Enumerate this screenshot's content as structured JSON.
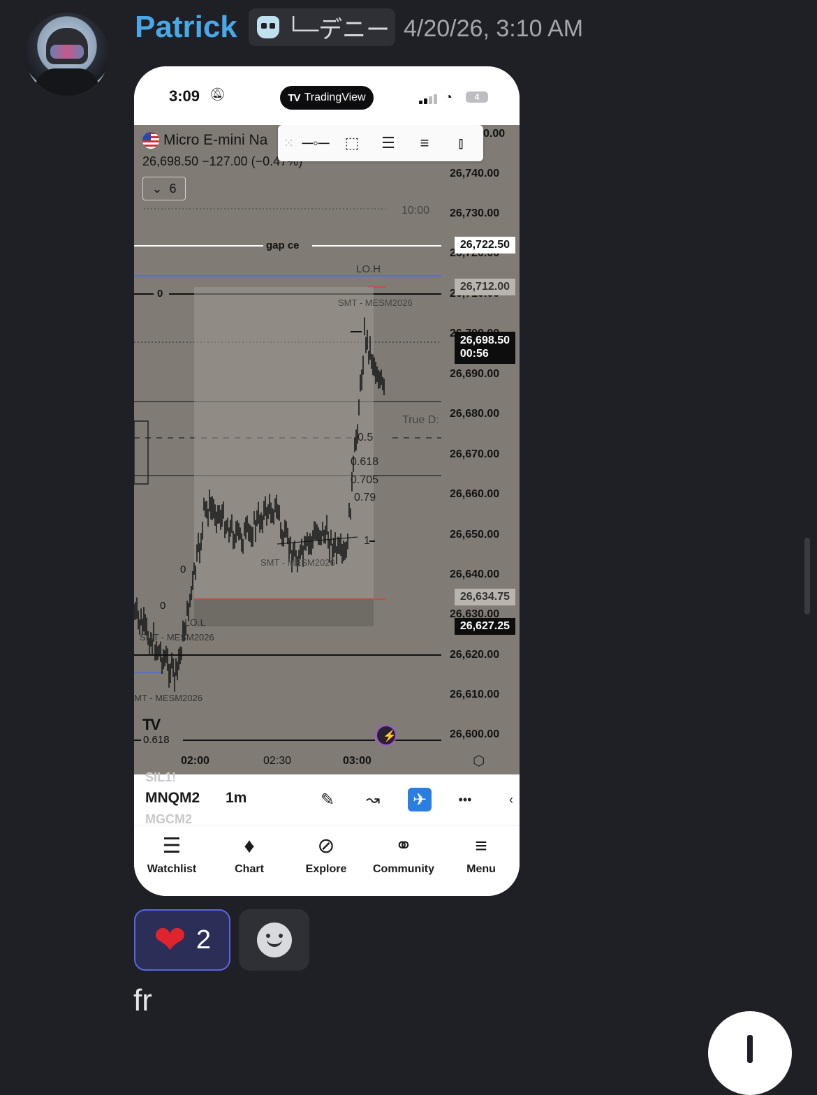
{
  "message": {
    "author": "Patrick",
    "tag": "└─デニー",
    "timestamp": "4/20/26, 3:10 AM",
    "text": "fr"
  },
  "reactions": [
    {
      "emoji": "heart",
      "count": "2",
      "active": true
    },
    {
      "emoji": "add-reaction-smiley",
      "count": "",
      "active": false
    }
  ],
  "screenshot": {
    "status_bar": {
      "time": "3:09",
      "app_pill": "TradingView",
      "battery": "4"
    },
    "symbol": {
      "name": "Micro E-mini Na",
      "quote": "26,698.50  −127.00 (−0.47%)",
      "dropdown": "6"
    },
    "toolbar_icons": [
      "horizontal-line-icon",
      "rectangle-icon",
      "parallel-lines-icon",
      "fib-levels-icon",
      "fib-timezone-icon"
    ],
    "price_axis": [
      "0.00",
      "26,740.00",
      "26,730.00",
      "26,720.00",
      "26,710.00",
      "26,700.00",
      "26,690.00",
      "26,680.00",
      "26,670.00",
      "26,660.00",
      "26,650.00",
      "26,640.00",
      "26,630.00",
      "26,620.00",
      "26,610.00",
      "26,600.00"
    ],
    "price_tags": {
      "gap_ce": "26,722.50",
      "lo_h": "26,712.00",
      "last": "26,698.50",
      "countdown": "00:56",
      "mid": "26,634.75",
      "low": "26,627.25"
    },
    "time_axis": [
      "02:00",
      "02:30",
      "03:00"
    ],
    "annotations": {
      "gap_ce": "gap ce",
      "lo_h": "LO.H",
      "smt_top": "SMT - MESM2026",
      "ten": "10:00",
      "true_d": "True D:",
      "zero": "0",
      "fib_05": "0.5",
      "fib_0618": "0.618",
      "fib_0705": "0.705",
      "fib_079": "0.79",
      "fib_1": "1",
      "smt_mid": "SMT - MESM2026",
      "smt_low": "SMT - MESM2026",
      "smt_left": "MT - MESM2026",
      "lo_l": "LO.L",
      "bottom_0618": "0.618",
      "left_0": "0",
      "left_0b": "0"
    },
    "bottom_bar": {
      "ghost_top": "SIL1!",
      "ticker": "MNQM2",
      "timeframe": "1m",
      "ghost_bottom": "MGCM2"
    },
    "nav": [
      "Watchlist",
      "Chart",
      "Explore",
      "Community",
      "Menu"
    ]
  }
}
